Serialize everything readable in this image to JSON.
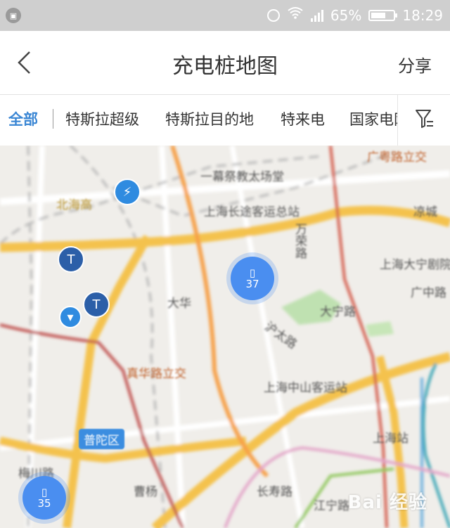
{
  "status_bar": {
    "battery_percent": "65%",
    "time": "18:29",
    "battery_level": 0.65
  },
  "header": {
    "title": "充电桩地图",
    "share_label": "分享"
  },
  "tabs": [
    {
      "label": "全部",
      "active": true
    },
    {
      "label": "特斯拉超级",
      "active": false
    },
    {
      "label": "特斯拉目的地",
      "active": false
    },
    {
      "label": "特来电",
      "active": false
    },
    {
      "label": "国家电网",
      "active": false
    }
  ],
  "map": {
    "labels": [
      {
        "text": "上海长途客运总站"
      },
      {
        "text": "万荣路"
      },
      {
        "text": "上海大宁剧院"
      },
      {
        "text": "广中路"
      },
      {
        "text": "大华"
      },
      {
        "text": "大宁路"
      },
      {
        "text": "沪太路"
      },
      {
        "text": "真华路立交"
      },
      {
        "text": "上海中山客运站"
      },
      {
        "text": "曹杨"
      },
      {
        "text": "长寿路"
      },
      {
        "text": "江宁路"
      },
      {
        "text": "上海站"
      },
      {
        "text": "梅川路"
      },
      {
        "text": "凉城"
      },
      {
        "text": "北海高"
      },
      {
        "text": "一幕祭教太场堂"
      },
      {
        "text": "广粤路立交"
      }
    ],
    "district": "普陀区",
    "clusters": [
      {
        "icon": "charging-pile-icon",
        "count": "37"
      },
      {
        "icon": "charging-pile-icon",
        "count": "35"
      }
    ],
    "watermark": "Bai 经验",
    "colors": {
      "main_road": "#f4c24d",
      "cluster": "#4a8ef0",
      "pin": "#2c5fa8",
      "accent": "#3a86d4"
    }
  }
}
